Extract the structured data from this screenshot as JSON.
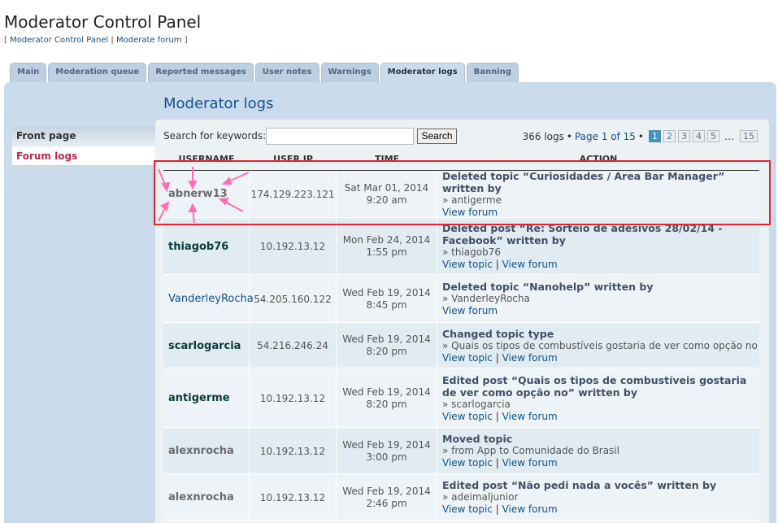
{
  "page": {
    "title": "Moderator Control Panel",
    "breadcrumb": {
      "open": "[",
      "link1": "Moderator Control Panel",
      "separator": "|",
      "link2": "Moderate forum",
      "close": "]"
    }
  },
  "tabs": [
    {
      "label": "Main"
    },
    {
      "label": "Moderation queue"
    },
    {
      "label": "Reported messages"
    },
    {
      "label": "User notes"
    },
    {
      "label": "Warnings"
    },
    {
      "label": "Moderator logs"
    },
    {
      "label": "Banning"
    }
  ],
  "sidebar": {
    "heading": "Front page",
    "item": "Forum logs"
  },
  "main": {
    "heading": "Moderator logs",
    "search_label": "Search for keywords:",
    "search_value": "",
    "search_button": "Search"
  },
  "pagination": {
    "summary": "366 logs",
    "bullet": "•",
    "page_text": "Page 1 of 15",
    "pages": [
      "1",
      "2",
      "3",
      "4",
      "5"
    ],
    "ellipsis": "…",
    "last": "15"
  },
  "table": {
    "headers": [
      "USERNAME",
      "USER IP",
      "TIME",
      "ACTION"
    ],
    "rows": [
      {
        "username": "abnerw13",
        "ip": "174.129.223.121",
        "date": "Sat Mar 01, 2014",
        "time": "9:20 am",
        "action": "Deleted topic “Curiosidades / Area Bar Manager” written by",
        "sub": "» antigerme",
        "link1": "",
        "link2": "View forum"
      },
      {
        "username": "thiagob76",
        "ip": "10.192.13.12",
        "date": "Mon Feb 24, 2014",
        "time": "1:55 pm",
        "action": "Deleted post “Re: Sorteio de adesivos 28/02/14 - Facebook” written by",
        "sub": "» thiagob76",
        "link1": "View topic",
        "link2": "View forum"
      },
      {
        "username": "VanderleyRocha",
        "ip": "54.205.160.122",
        "date": "Wed Feb 19, 2014",
        "time": "8:45 pm",
        "action": "Deleted topic “Nanohelp” written by",
        "sub": "» VanderleyRocha",
        "link1": "",
        "link2": "View forum"
      },
      {
        "username": "scarlogarcia",
        "ip": "54.216.246.24",
        "date": "Wed Feb 19, 2014",
        "time": "8:20 pm",
        "action": "Changed topic type",
        "sub": "» Quais os tipos de combustíveis gostaria de ver como opção no",
        "link1": "View topic",
        "link2": "View forum"
      },
      {
        "username": "antigerme",
        "ip": "10.192.13.12",
        "date": "Wed Feb 19, 2014",
        "time": "8:20 pm",
        "action": "Edited post “Quais os tipos de combustíveis gostaria de ver como opção no” written by",
        "sub": "» scarlogarcia",
        "link1": "View topic",
        "link2": "View forum"
      },
      {
        "username": "alexnrocha",
        "ip": "10.192.13.12",
        "date": "Wed Feb 19, 2014",
        "time": "3:00 pm",
        "action": "Moved topic",
        "sub": "» from App to Comunidade do Brasil",
        "link1": "View topic",
        "link2": "View forum"
      },
      {
        "username": "alexnrocha",
        "ip": "10.192.13.12",
        "date": "Wed Feb 19, 2014",
        "time": "2:46 pm",
        "action": "Edited post “Não pedi nada a vocês” written by",
        "sub": "» adeimaljunior",
        "link1": "View topic",
        "link2": "View forum"
      }
    ]
  },
  "colors": {
    "panel_bg": "#cadceb",
    "content_bg": "#ecf1f3",
    "link": "#105289",
    "active_menu": "#bc2a4d",
    "highlight": "#e5242c",
    "arrows": "#ff6fb5"
  },
  "icons": {
    "annotation": "pink-arrow-icon"
  }
}
